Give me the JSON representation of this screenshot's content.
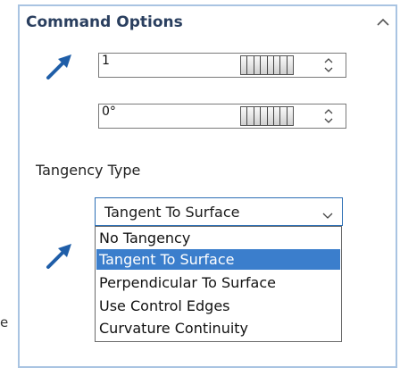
{
  "edge_fragment": "e",
  "panel": {
    "title": "Command Options"
  },
  "fields": [
    {
      "value": "1"
    },
    {
      "value": "0°"
    }
  ],
  "tangency": {
    "label": "Tangency Type",
    "selected": "Tangent To Surface",
    "options": [
      "No Tangency",
      "Tangent To Surface",
      "Perpendicular To Surface",
      "Use Control Edges",
      "Curvature Continuity"
    ]
  },
  "colors": {
    "accent": "#2c6fb5",
    "selection": "#3b7ecc",
    "arrow": "#1f5ea8"
  },
  "icons": {
    "row_arrow": "direction-arrow-icon",
    "collapse": "chevron-up-icon"
  }
}
